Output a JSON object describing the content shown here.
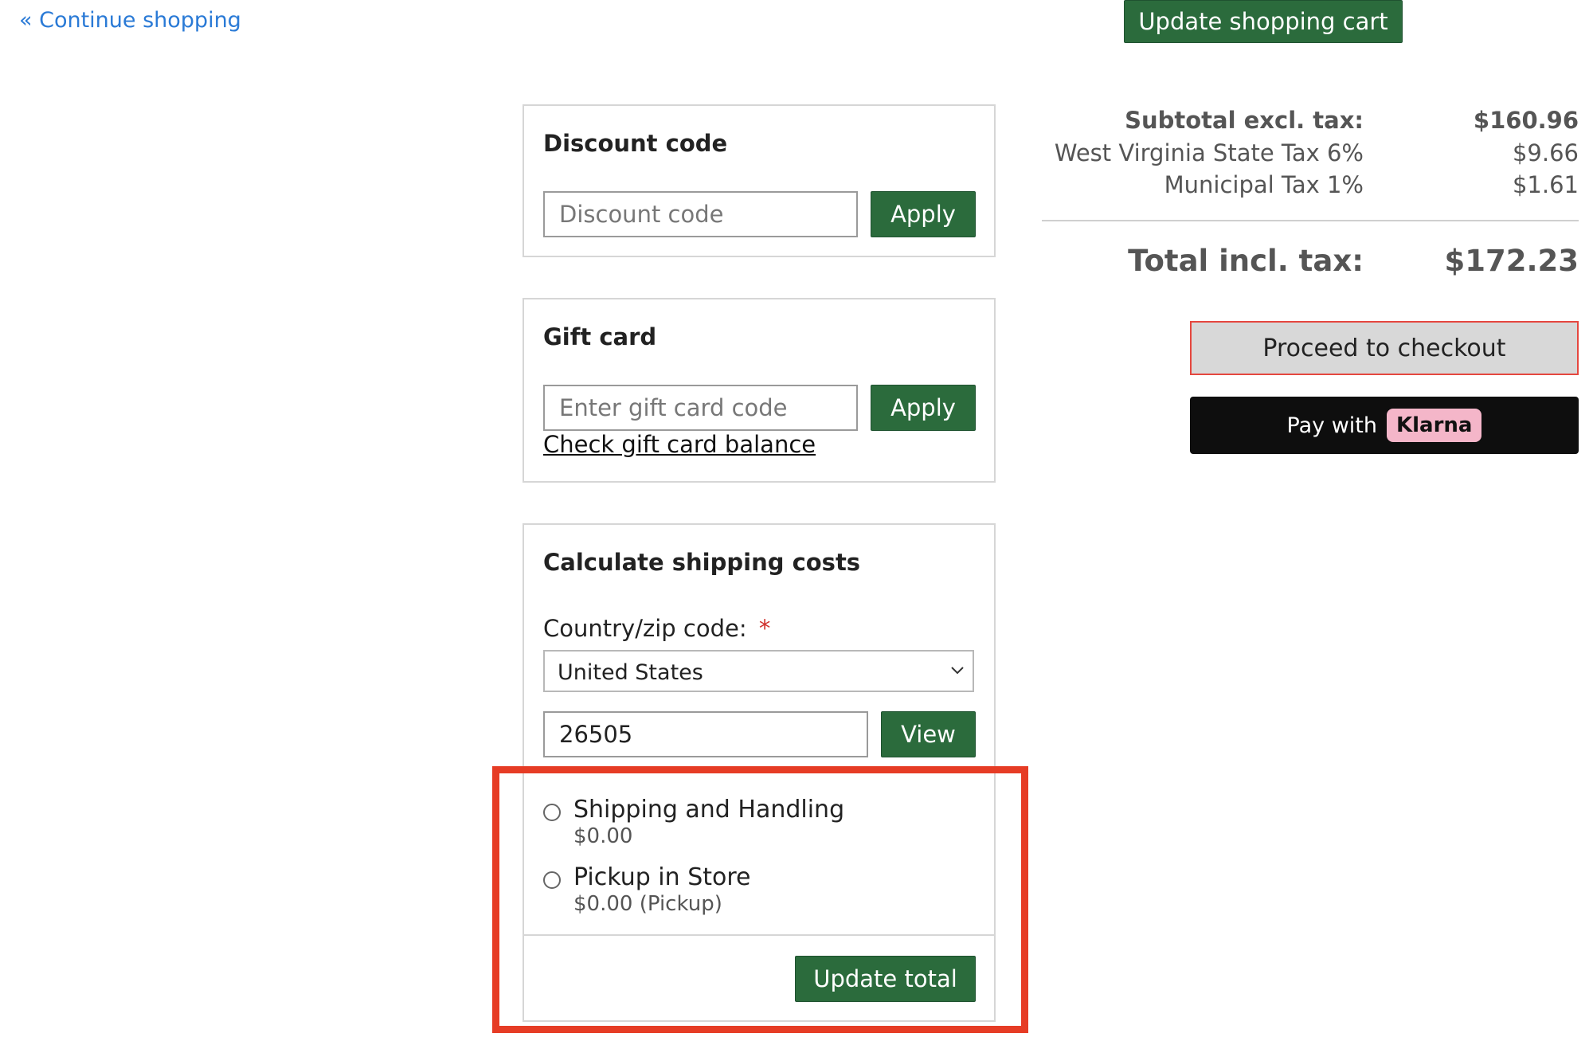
{
  "header": {
    "continue_shopping": "« Continue shopping",
    "update_cart_label": "Update shopping cart"
  },
  "discount": {
    "title": "Discount code",
    "placeholder": "Discount code",
    "apply_label": "Apply"
  },
  "gift_card": {
    "title": "Gift card",
    "placeholder": "Enter gift card code",
    "apply_label": "Apply",
    "balance_link": "Check gift card balance"
  },
  "shipping": {
    "title": "Calculate shipping costs",
    "country_label": "Country/zip code:",
    "required_mark": "*",
    "country_selected": "United States",
    "zip_value": "26505",
    "view_label": "View",
    "options": [
      {
        "name": "Shipping and Handling",
        "price": "$0.00"
      },
      {
        "name": "Pickup in Store",
        "price": "$0.00 (Pickup)"
      }
    ],
    "update_total_label": "Update total"
  },
  "summary": {
    "subtotal_label": "Subtotal excl. tax:",
    "subtotal_value": "$160.96",
    "state_tax_label": "West Virginia State Tax 6%",
    "state_tax_value": "$9.66",
    "municipal_tax_label": "Municipal Tax 1%",
    "municipal_tax_value": "$1.61",
    "total_label": "Total incl. tax:",
    "total_value": "$172.23",
    "checkout_label": "Proceed to checkout",
    "klarna_prefix": "Pay with",
    "klarna_logo": "Klarna"
  },
  "colors": {
    "accent_green": "#2b6b3c",
    "highlight_red": "#e63c25",
    "link_blue": "#2a7ad6",
    "klarna_pink": "#f4b6c9"
  }
}
